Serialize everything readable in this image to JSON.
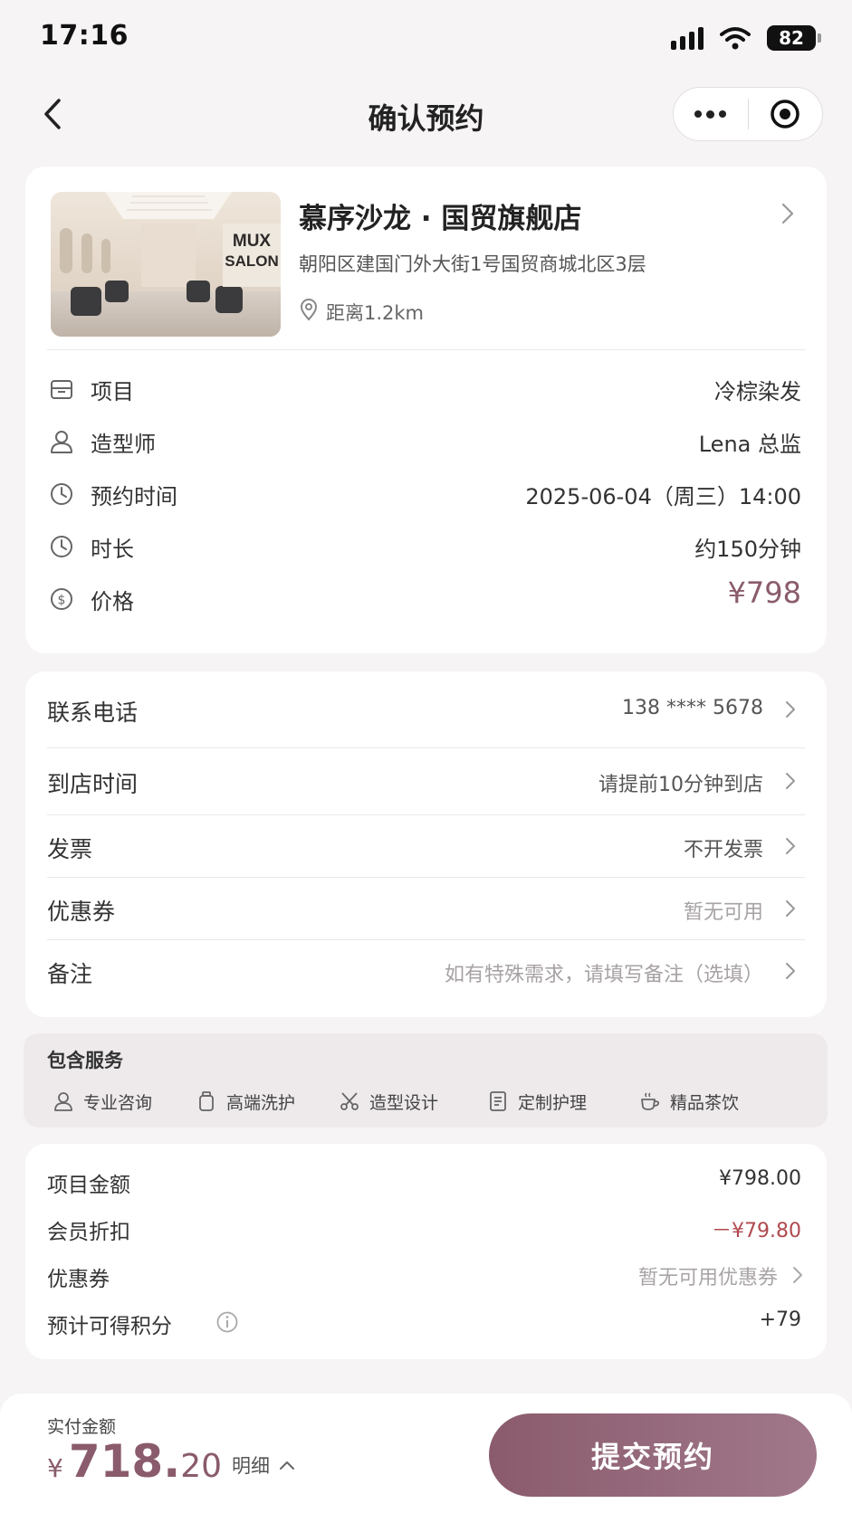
{
  "status_bar": {
    "time": "17:16",
    "battery": "82"
  },
  "nav": {
    "title": "确认预约"
  },
  "salon": {
    "name": "慕序沙龙 · 国贸旗舰店",
    "address": "朝阳区建国门外大街1号国贸商城北区3层",
    "distance": "距离1.2km",
    "photo_sign": [
      "MUX",
      "SALON"
    ]
  },
  "booking": [
    {
      "label": "项目",
      "value": "冷棕染发",
      "icon": "box-icon"
    },
    {
      "label": "造型师",
      "value": "Lena 总监",
      "icon": "person-icon"
    },
    {
      "label": "预约时间",
      "value": "2025-06-04（周三）14:00",
      "icon": "clock-icon"
    },
    {
      "label": "时长",
      "value": "约150分钟",
      "icon": "clock-icon"
    },
    {
      "label": "价格",
      "value": "¥798",
      "icon": "dollar-icon"
    }
  ],
  "form": [
    {
      "label": "联系电话",
      "value": "138 **** 5678",
      "muted": false
    },
    {
      "label": "到店时间",
      "value": "请提前10分钟到店",
      "muted": false
    },
    {
      "label": "发票",
      "value": "不开发票",
      "muted": false
    },
    {
      "label": "优惠券",
      "value": "暂无可用",
      "muted": true
    },
    {
      "label": "备注",
      "value": "如有特殊需求，请填写备注（选填）",
      "muted": true
    }
  ],
  "services": {
    "title": "包含服务",
    "items": [
      {
        "label": "专业咨询",
        "icon": "person-icon"
      },
      {
        "label": "高端洗护",
        "icon": "bottle-icon"
      },
      {
        "label": "造型设计",
        "icon": "scissors-icon"
      },
      {
        "label": "定制护理",
        "icon": "document-icon"
      },
      {
        "label": "精品茶饮",
        "icon": "cup-icon"
      }
    ]
  },
  "amounts": {
    "item_label": "项目金额",
    "item_value": "¥798.00",
    "member_label": "会员折扣",
    "member_value": "－¥79.80",
    "coupon_label": "优惠券",
    "coupon_value": "暂无可用优惠券",
    "points_label": "预计可得积分",
    "points_value": "+79"
  },
  "colors": {
    "accent": "#8a5b6c",
    "discount": "#b04a4f",
    "background": "#f6f4f5"
  },
  "bottom": {
    "pay_label": "实付金额",
    "currency": "¥",
    "amount_int": "718.",
    "amount_dec": "20",
    "detail_label": "明细",
    "submit_label": "提交预约"
  }
}
